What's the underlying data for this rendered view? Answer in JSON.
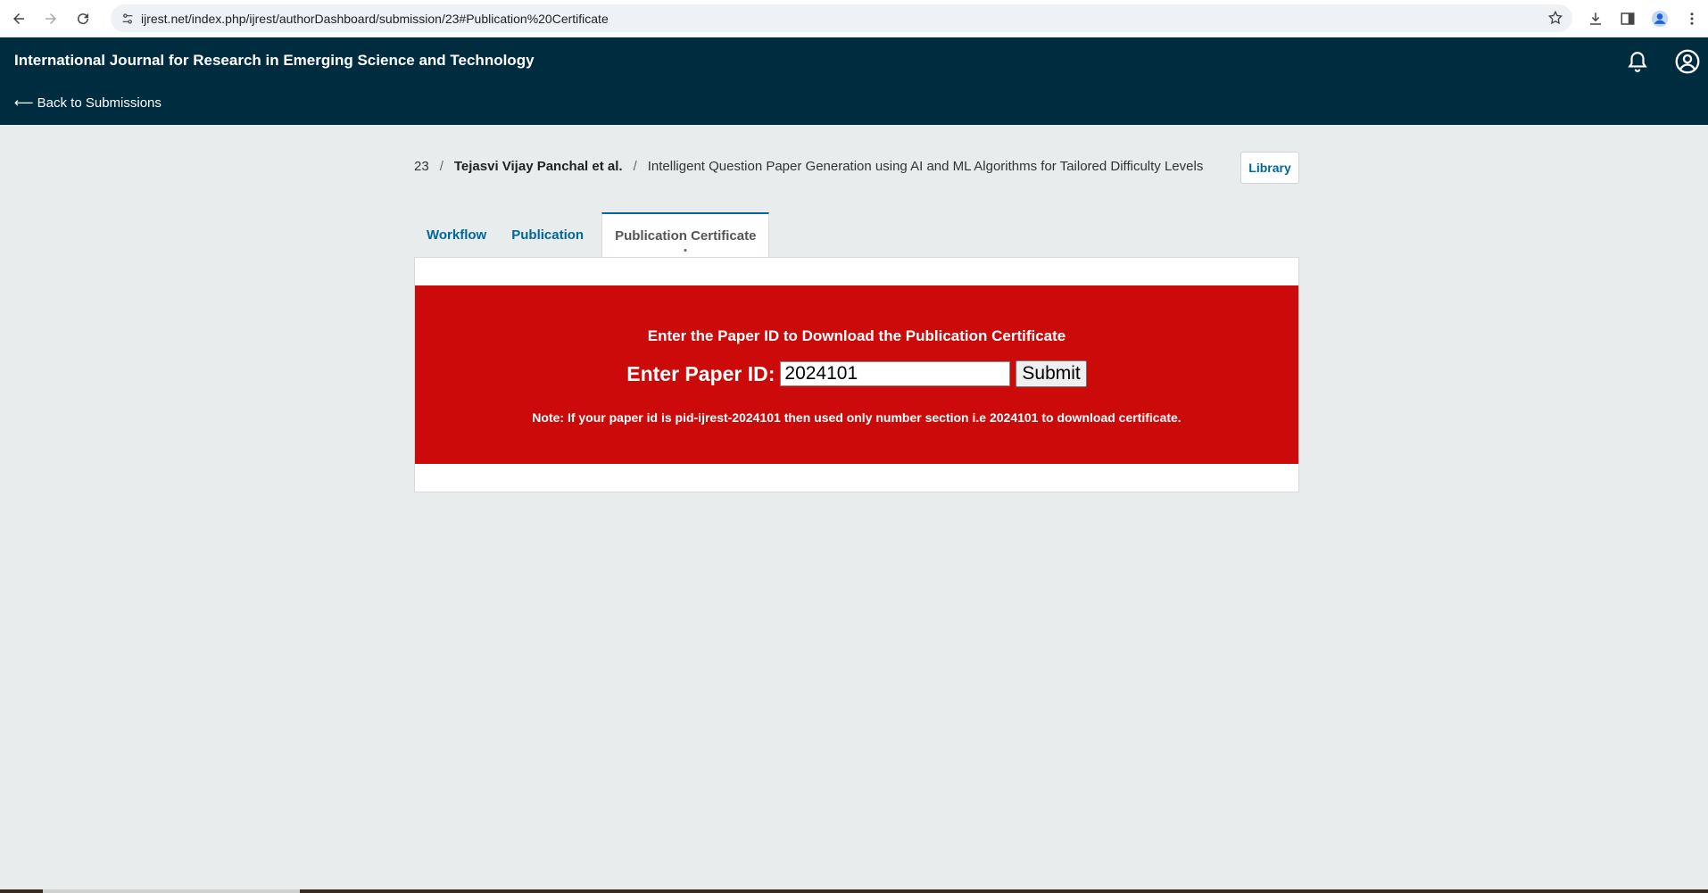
{
  "browser": {
    "url": "ijrest.net/index.php/ijrest/authorDashboard/submission/23#Publication%20Certificate"
  },
  "header": {
    "journal_title": "International Journal for Research in Emerging Science and Technology",
    "back_link": "⟵ Back to Submissions"
  },
  "breadcrumb": {
    "submission_id": "23",
    "separator": "/",
    "author": "Tejasvi Vijay Panchal et al.",
    "title": "Intelligent Question Paper Generation using AI and ML Algorithms for Tailored Difficulty Levels"
  },
  "library_label": "Library",
  "tabs": [
    {
      "label": "Workflow"
    },
    {
      "label": "Publication"
    },
    {
      "label": "Publication Certificate"
    }
  ],
  "certificate": {
    "heading": "Enter the Paper ID to Download the Publication Certificate",
    "input_label": "Enter Paper ID:",
    "input_value": "2024101",
    "submit_label": "Submit",
    "note": "Note: If your paper id is pid-ijrest-2024101 then used only number section i.e 2024101 to download certificate."
  },
  "colors": {
    "header_bg": "#002c40",
    "accent": "#006798",
    "alert_red": "#cc0a0a"
  }
}
